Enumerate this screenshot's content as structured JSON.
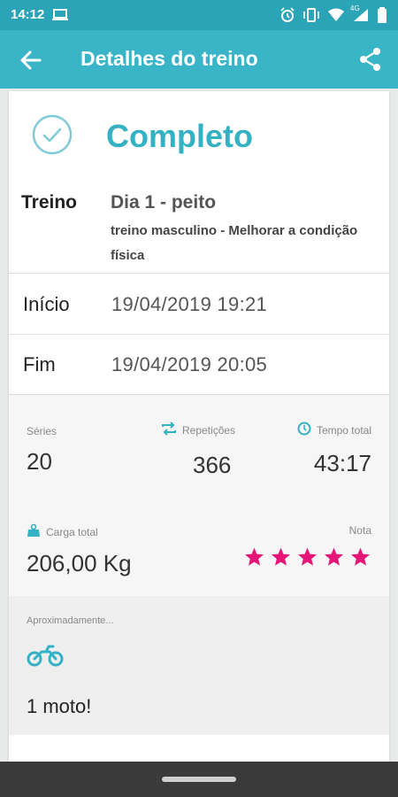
{
  "status_bar": {
    "time": "14:12",
    "network": "4G"
  },
  "app_bar": {
    "title": "Detalhes do treino"
  },
  "workout": {
    "status": "Completo",
    "treino_label": "Treino",
    "treino_name": "Dia 1 - peito",
    "treino_description": "treino masculino - Melhorar a condição física",
    "inicio_label": "Início",
    "inicio_value": "19/04/2019 19:21",
    "fim_label": "Fim",
    "fim_value": "19/04/2019 20:05"
  },
  "stats": {
    "series_label": "Séries",
    "series_value": "20",
    "repeticoes_label": "Repetições",
    "repeticoes_value": "366",
    "tempo_label": "Tempo total",
    "tempo_value": "43:17",
    "carga_label": "Carga total",
    "carga_value": "206,00 Kg",
    "nota_label": "Nota",
    "nota_stars": 5,
    "nota_max": 5
  },
  "approx": {
    "label": "Aproximadamente...",
    "text": "1 moto!"
  },
  "colors": {
    "accent": "#35b1c4",
    "appbar": "#3ab5c8",
    "statusbar": "#2aa4b6",
    "star": "#e6157a"
  },
  "icons": [
    "laptop-icon",
    "alarm-icon",
    "vibrate-icon",
    "wifi-icon",
    "signal-icon",
    "battery-icon",
    "back-arrow-icon",
    "share-icon",
    "check-circle-icon",
    "repeat-icon",
    "clock-icon",
    "weight-icon",
    "star-icon",
    "motorcycle-icon"
  ]
}
